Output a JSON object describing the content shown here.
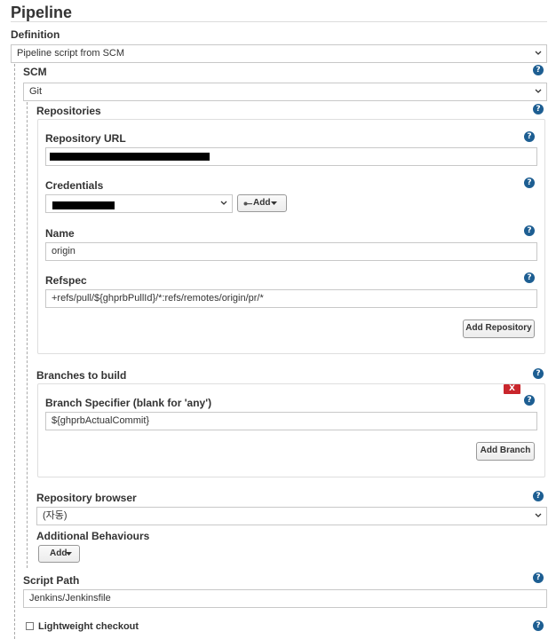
{
  "section_title": "Pipeline",
  "definition": {
    "label": "Definition",
    "value": "Pipeline script from SCM"
  },
  "scm": {
    "label": "SCM",
    "value": "Git"
  },
  "repositories": {
    "label": "Repositories",
    "url_label": "Repository URL",
    "credentials_label": "Credentials",
    "add_button": "Add",
    "name_label": "Name",
    "name_value": "origin",
    "refspec_label": "Refspec",
    "refspec_value": "+refs/pull/${ghprbPullId}/*:refs/remotes/origin/pr/*",
    "add_repository_button": "Add Repository"
  },
  "branches": {
    "label": "Branches to build",
    "delete_button": "X",
    "specifier_label": "Branch Specifier (blank for 'any')",
    "specifier_value": "${ghprbActualCommit}",
    "add_branch_button": "Add Branch"
  },
  "repository_browser": {
    "label": "Repository browser",
    "value": "(자동)"
  },
  "additional_behaviours": {
    "label": "Additional Behaviours",
    "add_button": "Add"
  },
  "script_path": {
    "label": "Script Path",
    "value": "Jenkins/Jenkinsfile"
  },
  "lightweight_checkout": {
    "label": "Lightweight checkout"
  },
  "colors": {
    "help_icon": "#1d5e92",
    "delete_button": "#c9262c"
  }
}
